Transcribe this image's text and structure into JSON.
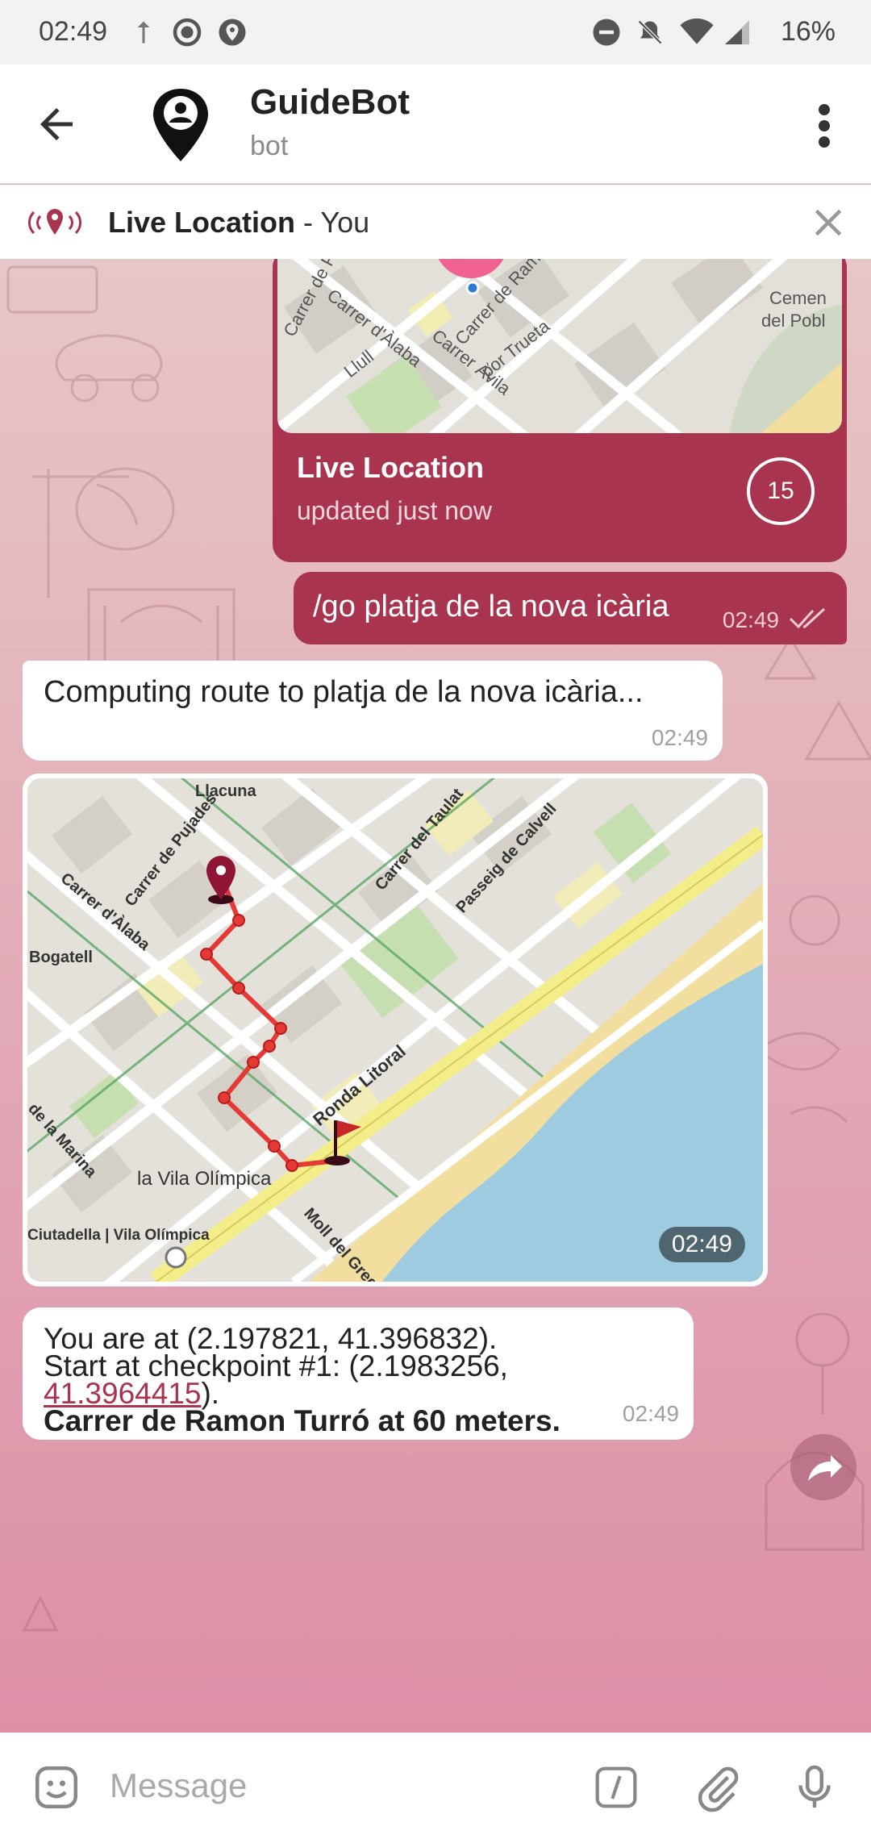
{
  "status_bar": {
    "time": "02:49",
    "battery": "16%"
  },
  "header": {
    "title": "GuideBot",
    "subtitle": "bot"
  },
  "live_bar": {
    "label": "Live Location",
    "suffix": " - You"
  },
  "live_location_card": {
    "title": "Live Location",
    "subtitle": "updated just now",
    "timer": "15",
    "map_labels": [
      "Carrer de Pere IV",
      "Carrer d'Àlaba",
      "Carrer de Ramon",
      "Carrer Àvila",
      "por Trueta",
      "Llull",
      "Cemen",
      "del Pobl"
    ]
  },
  "outgoing_message": {
    "text": "/go platja de la nova icària",
    "time": "02:49"
  },
  "incoming_message_1": {
    "text": "Computing route to platja de la nova icària...",
    "time": "02:49"
  },
  "route_map": {
    "time": "02:49",
    "labels": {
      "llacuna": "Llacuna",
      "pujades": "Carrer de Pujades",
      "alaba": "Carrer d'Àlaba",
      "taulat": "Carrer del Taulat",
      "calvell": "Passeig de Calvell",
      "bogatell": "Bogatell",
      "ronda": "Ronda Litoral",
      "marina": "de la Marina",
      "vila": "la Vila Olímpica",
      "ciutadella": "Ciutadella | Vila Olímpica",
      "gregal": "Moll del Gregal"
    }
  },
  "incoming_message_2": {
    "line1": "You are at (2.197821, 41.396832).",
    "line2": "Start at checkpoint #1: (2.1983256,",
    "link": "41.3964415",
    "line3_rest": ").",
    "line4": "Carrer de Ramon Turró at 60 meters.",
    "time": "02:49"
  },
  "input": {
    "placeholder": "Message"
  },
  "colors": {
    "accent": "#a93450",
    "route": "#e53935",
    "water": "#9fcbe0",
    "sand": "#f2dfa0"
  }
}
